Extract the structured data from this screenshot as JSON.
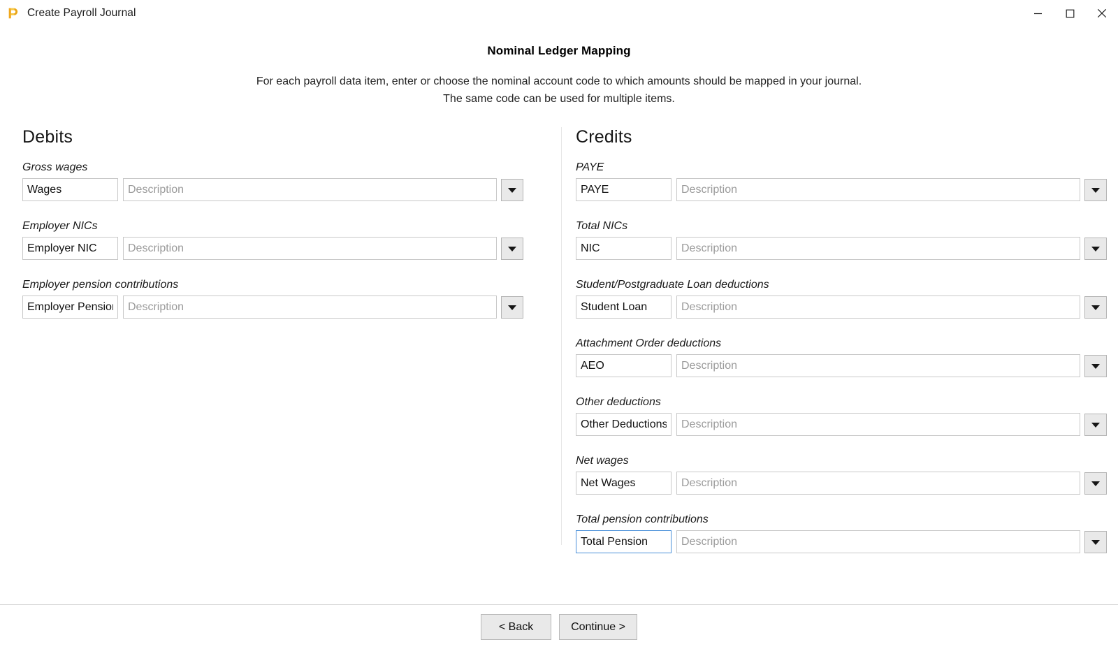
{
  "window": {
    "title": "Create Payroll Journal",
    "app_icon": "payroll-app-icon",
    "icon_color": "#F0A81E",
    "controls": {
      "minimize": "minimize-icon",
      "maximize": "maximize-icon",
      "close": "close-icon"
    }
  },
  "header": {
    "title": "Nominal Ledger Mapping",
    "description_line1": "For each payroll data item, enter or choose the nominal account code to which amounts should be mapped in your journal.",
    "description_line2": "The same code can be used for multiple items."
  },
  "common": {
    "description_placeholder": "Description",
    "dropdown_icon": "chevron-down-icon",
    "focus_color": "#4A90D9"
  },
  "debits": {
    "heading": "Debits",
    "rows": [
      {
        "label": "Gross wages",
        "code": "Wages",
        "description": "",
        "focused": false
      },
      {
        "label": "Employer NICs",
        "code": "Employer NIC",
        "description": "",
        "focused": false
      },
      {
        "label": "Employer pension contributions",
        "code": "Employer Pension",
        "description": "",
        "focused": false
      }
    ]
  },
  "credits": {
    "heading": "Credits",
    "rows": [
      {
        "label": "PAYE",
        "code": "PAYE",
        "description": "",
        "focused": false
      },
      {
        "label": "Total NICs",
        "code": "NIC",
        "description": "",
        "focused": false
      },
      {
        "label": "Student/Postgraduate Loan deductions",
        "code": "Student Loan",
        "description": "",
        "focused": false
      },
      {
        "label": "Attachment Order deductions",
        "code": "AEO",
        "description": "",
        "focused": false
      },
      {
        "label": "Other deductions",
        "code": "Other Deductions",
        "description": "",
        "focused": false
      },
      {
        "label": "Net wages",
        "code": "Net Wages",
        "description": "",
        "focused": false
      },
      {
        "label": "Total pension contributions",
        "code": "Total Pension",
        "description": "",
        "focused": true
      }
    ]
  },
  "footer": {
    "back_label": "< Back",
    "continue_label": "Continue >"
  }
}
